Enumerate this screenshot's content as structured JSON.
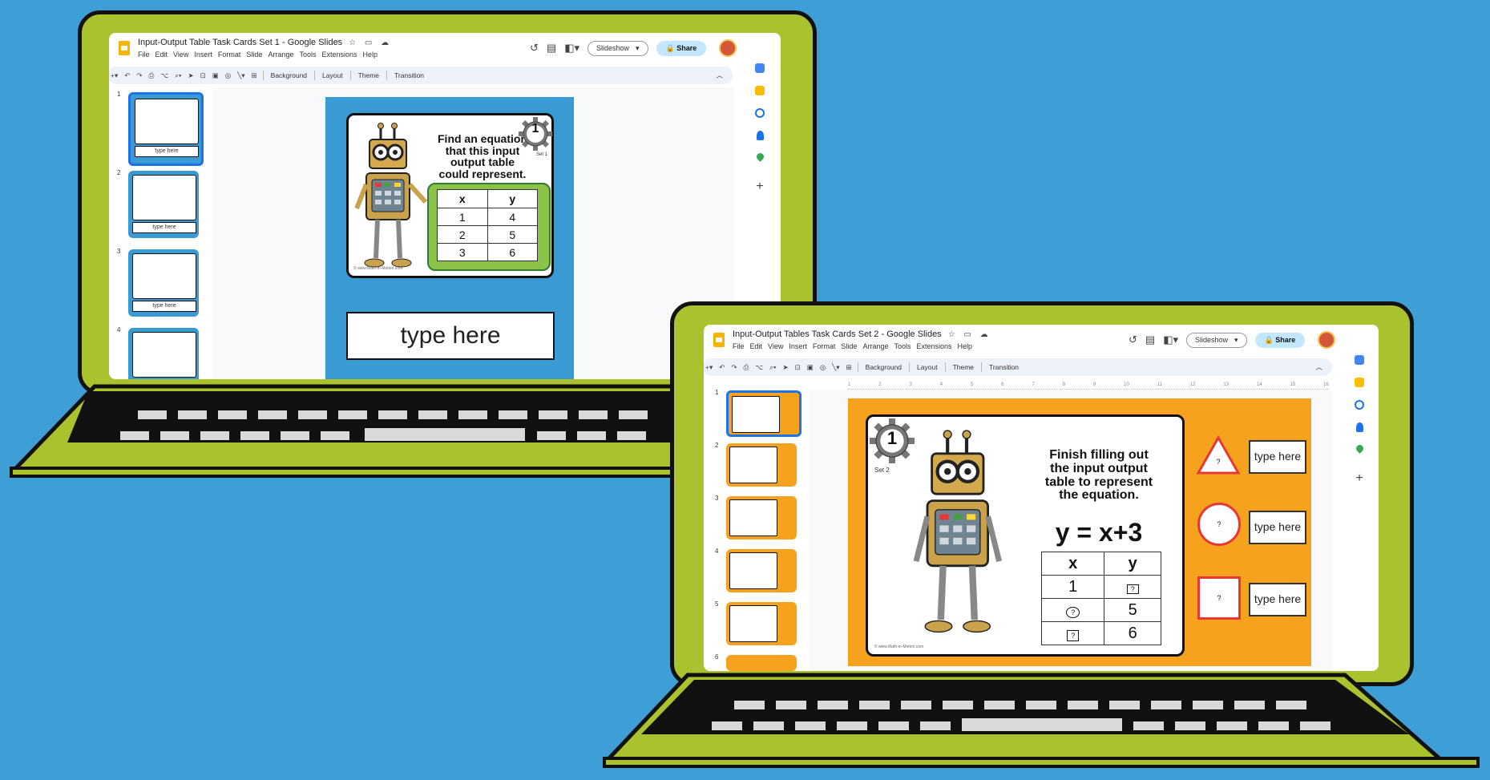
{
  "colors": {
    "background": "#3d9fd6",
    "bezel": "#a9c22e",
    "slide1_bg": "#3a9bd4",
    "slide2_bg": "#f6a21e"
  },
  "laptop1": {
    "doc_title": "Input-Output Table Task Cards Set 1 - Google Slides",
    "menu": [
      "File",
      "Edit",
      "View",
      "Insert",
      "Format",
      "Slide",
      "Arrange",
      "Tools",
      "Extensions",
      "Help"
    ],
    "slideshow_label": "Slideshow",
    "share_label": "Share",
    "toolbar": {
      "background": "Background",
      "layout": "Layout",
      "theme": "Theme",
      "transition": "Transition"
    },
    "thumb_numbers": [
      "1",
      "2",
      "3",
      "4"
    ],
    "thumb_answer": "type here",
    "slide": {
      "prompt": "Find an equation that this input output table could represent.",
      "set_label": "Set 1",
      "card_number": "1",
      "table_headers": [
        "x",
        "y"
      ],
      "table_rows": [
        [
          "1",
          "4"
        ],
        [
          "2",
          "5"
        ],
        [
          "3",
          "6"
        ]
      ],
      "answer_placeholder": "type here",
      "footer": "© www.Math-in-Motion.com"
    }
  },
  "laptop2": {
    "doc_title": "Input-Output Tables Task Cards Set 2 - Google Slides",
    "menu": [
      "File",
      "Edit",
      "View",
      "Insert",
      "Format",
      "Slide",
      "Arrange",
      "Tools",
      "Extensions",
      "Help"
    ],
    "slideshow_label": "Slideshow",
    "share_label": "Share",
    "toolbar": {
      "background": "Background",
      "layout": "Layout",
      "theme": "Theme",
      "transition": "Transition"
    },
    "ruler_numbers": [
      "1",
      "2",
      "3",
      "4",
      "5",
      "6",
      "7",
      "8",
      "9",
      "10",
      "11",
      "12",
      "13",
      "14",
      "15",
      "16"
    ],
    "thumb_numbers": [
      "1",
      "2",
      "3",
      "4",
      "5",
      "6"
    ],
    "slide": {
      "prompt": "Finish filling out the input output table to represent the equation.",
      "equation": "y = x+3",
      "set_label": "Set 2",
      "card_number": "1",
      "table_headers": [
        "x",
        "y"
      ],
      "table_rows": [
        [
          "1",
          "?"
        ],
        [
          "?",
          "5"
        ],
        [
          "?",
          "6"
        ]
      ],
      "shape_mark": "?",
      "answer_placeholder": "type here",
      "footer": "© www.Math-in-Motion.com"
    }
  }
}
